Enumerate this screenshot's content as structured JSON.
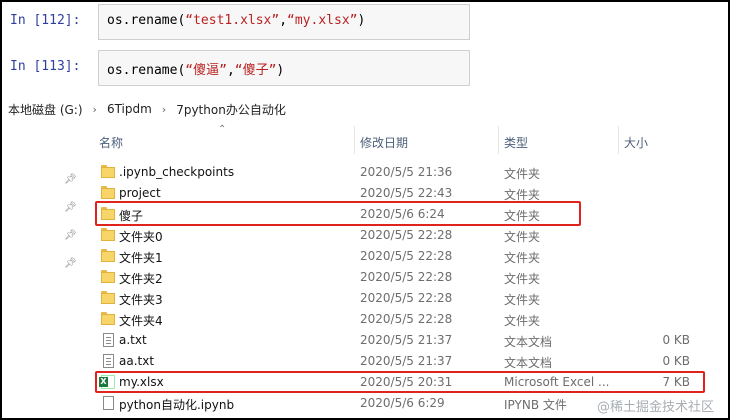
{
  "notebook": {
    "cells": [
      {
        "prompt": "In  [112]:",
        "code_fn": "os.rename(",
        "arg1": "“test1.xlsx”",
        "comma": ",",
        "arg2": "“my.xlsx”",
        "close": ")"
      },
      {
        "prompt": "In  [113]:",
        "code_fn": "os.rename(",
        "arg1": "“傻逼”",
        "comma": ",",
        "arg2": "“傻子”",
        "close": ")"
      }
    ]
  },
  "explorer": {
    "breadcrumb": [
      "本地磁盘 (G:)",
      "6Tipdm",
      "7python办公自动化"
    ],
    "separator": "›",
    "columns": {
      "name": "名称",
      "date": "修改日期",
      "type": "类型",
      "size": "大小"
    },
    "files": [
      {
        "name": ".ipynb_checkpoints",
        "date": "2020/5/5 21:36",
        "type": "文件夹",
        "size": "",
        "icon": "folder-icon"
      },
      {
        "name": "project",
        "date": "2020/5/5 22:43",
        "type": "文件夹",
        "size": "",
        "icon": "folder-icon"
      },
      {
        "name": "傻子",
        "date": "2020/5/6 6:24",
        "type": "文件夹",
        "size": "",
        "icon": "folder-icon"
      },
      {
        "name": "文件夹0",
        "date": "2020/5/5 22:28",
        "type": "文件夹",
        "size": "",
        "icon": "folder-icon"
      },
      {
        "name": "文件夹1",
        "date": "2020/5/5 22:28",
        "type": "文件夹",
        "size": "",
        "icon": "folder-icon"
      },
      {
        "name": "文件夹2",
        "date": "2020/5/5 22:28",
        "type": "文件夹",
        "size": "",
        "icon": "folder-icon"
      },
      {
        "name": "文件夹3",
        "date": "2020/5/5 22:28",
        "type": "文件夹",
        "size": "",
        "icon": "folder-icon"
      },
      {
        "name": "文件夹4",
        "date": "2020/5/5 22:28",
        "type": "文件夹",
        "size": "",
        "icon": "folder-icon"
      },
      {
        "name": "a.txt",
        "date": "2020/5/5 21:37",
        "type": "文本文档",
        "size": "0 KB",
        "icon": "text-file-icon"
      },
      {
        "name": "aa.txt",
        "date": "2020/5/5 21:37",
        "type": "文本文档",
        "size": "0 KB",
        "icon": "text-file-icon"
      },
      {
        "name": "my.xlsx",
        "date": "2020/5/5 20:31",
        "type": "Microsoft Excel ...",
        "size": "7 KB",
        "icon": "excel-file-icon"
      },
      {
        "name": "python自动化.ipynb",
        "date": "2020/5/6 6:29",
        "type": "IPYNB 文件",
        "size": "",
        "icon": "notebook-file-icon"
      }
    ]
  },
  "colors": {
    "highlight": "#e0231c",
    "prompt": "#303f9f",
    "string": "#ba2121"
  },
  "watermark": "@稀土掘金技术社区"
}
